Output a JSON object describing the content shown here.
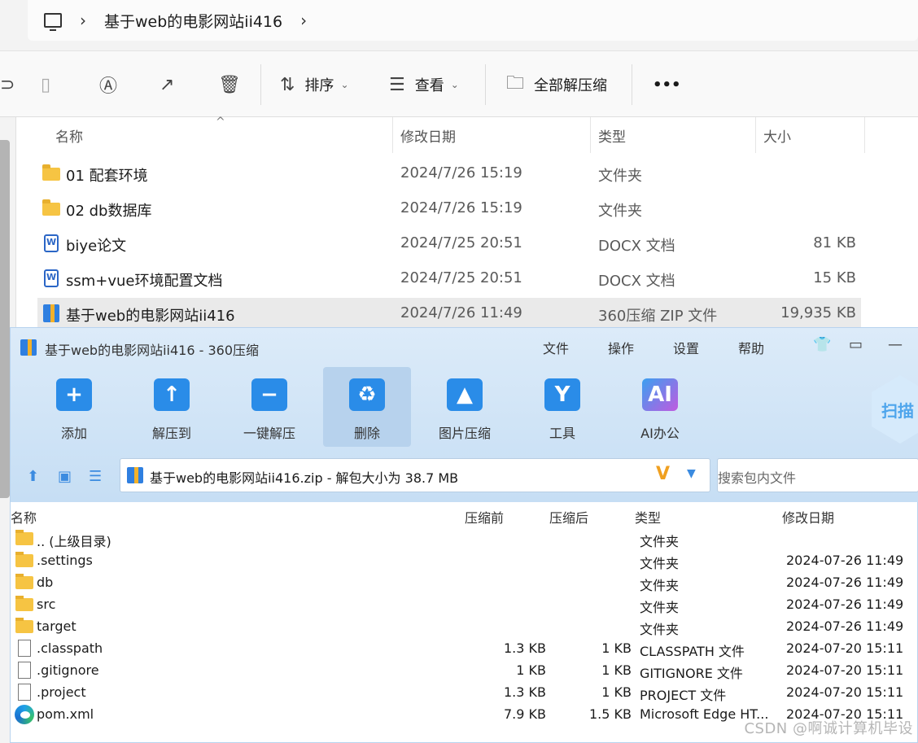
{
  "explorer": {
    "breadcrumb": "基于web的电影网站ii416",
    "toolbar": {
      "sort_label": "排序",
      "view_label": "查看",
      "extract_all_label": "全部解压缩",
      "more_label": "•••"
    },
    "columns": {
      "name": "名称",
      "modified": "修改日期",
      "type": "类型",
      "size": "大小"
    },
    "files": [
      {
        "icon": "folder-icon",
        "name": "01 配套环境",
        "modified": "2024/7/26 15:19",
        "type": "文件夹",
        "size": ""
      },
      {
        "icon": "folder-icon",
        "name": "02 db数据库",
        "modified": "2024/7/26 15:19",
        "type": "文件夹",
        "size": ""
      },
      {
        "icon": "word-doc-icon",
        "name": "biye论文",
        "modified": "2024/7/25 20:51",
        "type": "DOCX 文档",
        "size": "81 KB"
      },
      {
        "icon": "word-doc-icon",
        "name": "ssm+vue环境配置文档",
        "modified": "2024/7/25 20:51",
        "type": "DOCX 文档",
        "size": "15 KB"
      },
      {
        "icon": "zip-archive-icon",
        "name": "基于web的电影网站ii416",
        "modified": "2024/7/26 11:49",
        "type": "360压缩 ZIP 文件",
        "size": "19,935 KB"
      }
    ]
  },
  "zip_window": {
    "title": "基于web的电影网站ii416 - 360压缩",
    "menu": [
      "文件",
      "操作",
      "设置",
      "帮助"
    ],
    "tools": [
      {
        "label": "添加",
        "glyph": "+"
      },
      {
        "label": "解压到",
        "glyph": "↑"
      },
      {
        "label": "一键解压",
        "glyph": "−"
      },
      {
        "label": "删除",
        "glyph": "♻"
      },
      {
        "label": "图片压缩",
        "glyph": "▲"
      },
      {
        "label": "工具",
        "glyph": "Y"
      },
      {
        "label": "AI办公",
        "glyph": "AI"
      }
    ],
    "scan_label": "扫描",
    "path_text": "基于web的电影网站ii416.zip - 解包大小为 38.7 MB",
    "path_badge": "V",
    "search_placeholder": "搜索包内文件",
    "columns": {
      "name": "名称",
      "before": "压缩前",
      "after": "压缩后",
      "type": "类型",
      "modified": "修改日期"
    },
    "entries": [
      {
        "icon": "folder-icon",
        "name": ".. (上级目录)",
        "before": "",
        "after": "",
        "type": "文件夹",
        "modified": ""
      },
      {
        "icon": "folder-icon",
        "name": ".settings",
        "before": "",
        "after": "",
        "type": "文件夹",
        "modified": "2024-07-26 11:49"
      },
      {
        "icon": "folder-icon",
        "name": "db",
        "before": "",
        "after": "",
        "type": "文件夹",
        "modified": "2024-07-26 11:49"
      },
      {
        "icon": "folder-icon",
        "name": "src",
        "before": "",
        "after": "",
        "type": "文件夹",
        "modified": "2024-07-26 11:49"
      },
      {
        "icon": "folder-icon",
        "name": "target",
        "before": "",
        "after": "",
        "type": "文件夹",
        "modified": "2024-07-26 11:49"
      },
      {
        "icon": "file-icon",
        "name": ".classpath",
        "before": "1.3 KB",
        "after": "1 KB",
        "type": "CLASSPATH 文件",
        "modified": "2024-07-20 15:11"
      },
      {
        "icon": "file-icon",
        "name": ".gitignore",
        "before": "1 KB",
        "after": "1 KB",
        "type": "GITIGNORE 文件",
        "modified": "2024-07-20 15:11"
      },
      {
        "icon": "file-icon",
        "name": ".project",
        "before": "1.3 KB",
        "after": "1 KB",
        "type": "PROJECT 文件",
        "modified": "2024-07-20 15:11"
      },
      {
        "icon": "edge-icon",
        "name": "pom.xml",
        "before": "7.9 KB",
        "after": "1.5 KB",
        "type": "Microsoft Edge HT...",
        "modified": "2024-07-20 15:11"
      }
    ]
  },
  "watermark": "CSDN @啊诚计算机毕设"
}
